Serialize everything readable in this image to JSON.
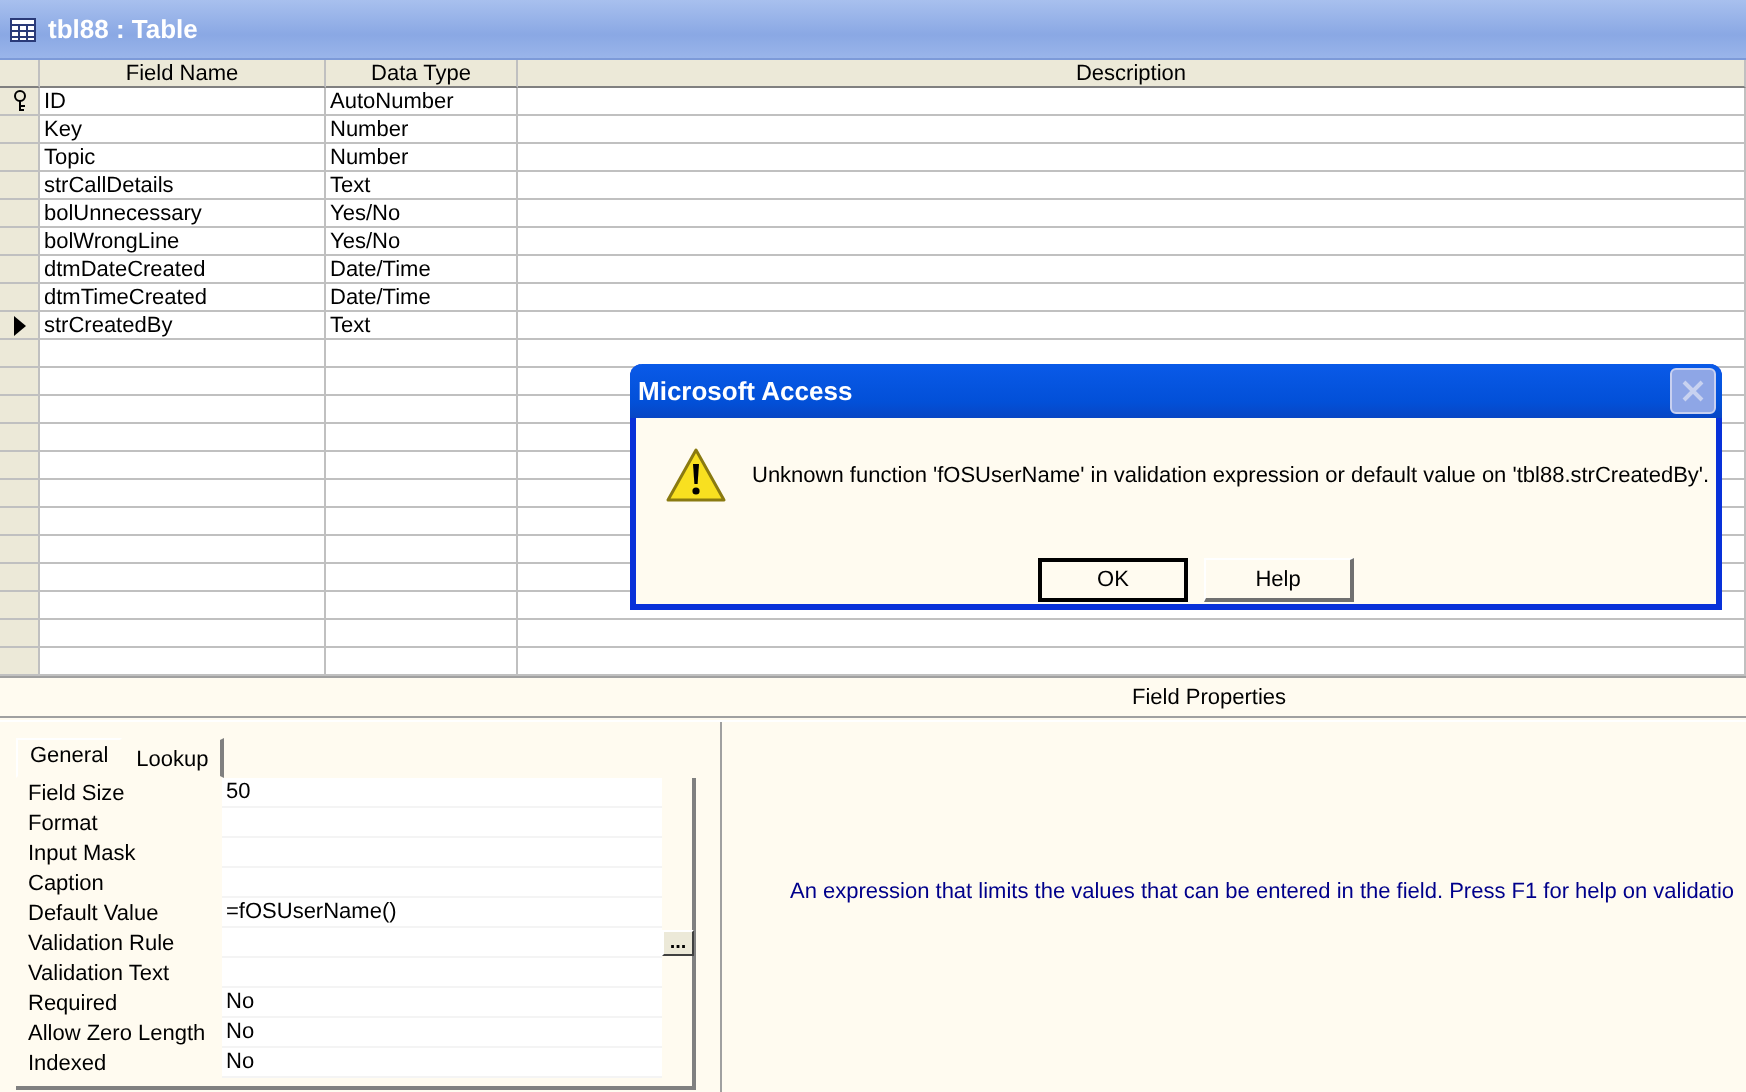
{
  "window": {
    "title": "tbl88 : Table"
  },
  "table": {
    "columns": [
      "Field Name",
      "Data Type",
      "Description"
    ],
    "rows": [
      {
        "field_name": "ID",
        "data_type": "AutoNumber",
        "primary_key": true,
        "selected": false
      },
      {
        "field_name": "Key",
        "data_type": "Number",
        "primary_key": false,
        "selected": false
      },
      {
        "field_name": "Topic",
        "data_type": "Number",
        "primary_key": false,
        "selected": false
      },
      {
        "field_name": "strCallDetails",
        "data_type": "Text",
        "primary_key": false,
        "selected": false
      },
      {
        "field_name": "bolUnnecessary",
        "data_type": "Yes/No",
        "primary_key": false,
        "selected": false
      },
      {
        "field_name": "bolWrongLine",
        "data_type": "Yes/No",
        "primary_key": false,
        "selected": false
      },
      {
        "field_name": "dtmDateCreated",
        "data_type": "Date/Time",
        "primary_key": false,
        "selected": false
      },
      {
        "field_name": "dtmTimeCreated",
        "data_type": "Date/Time",
        "primary_key": false,
        "selected": false
      },
      {
        "field_name": "strCreatedBy",
        "data_type": "Text",
        "primary_key": false,
        "selected": true
      }
    ]
  },
  "field_properties": {
    "title": "Field Properties",
    "tabs": [
      {
        "label": "General",
        "selected": true
      },
      {
        "label": "Lookup",
        "selected": false
      }
    ],
    "properties": [
      {
        "label": "Field Size",
        "value": "50"
      },
      {
        "label": "Format"
      },
      {
        "label": "Input Mask"
      },
      {
        "label": "Caption"
      },
      {
        "label": "Default Value",
        "value": "=fOSUserName()"
      },
      {
        "label": "Validation Rule",
        "builder_button": "..."
      },
      {
        "label": "Validation Text"
      },
      {
        "label": "Required",
        "value": "No"
      },
      {
        "label": "Allow Zero Length",
        "value": "No"
      },
      {
        "label": "Indexed",
        "value": "No"
      }
    ],
    "help_text": "An expression that limits the values that can be entered in the field.  Press F1 for help on validatio"
  },
  "dialog": {
    "title": "Microsoft Access",
    "message": "Unknown function 'fOSUserName' in validation expression or default value on 'tbl88.strCreatedBy'.",
    "buttons": [
      {
        "label": "OK",
        "default": true
      },
      {
        "label": "Help",
        "default": false
      }
    ]
  }
}
